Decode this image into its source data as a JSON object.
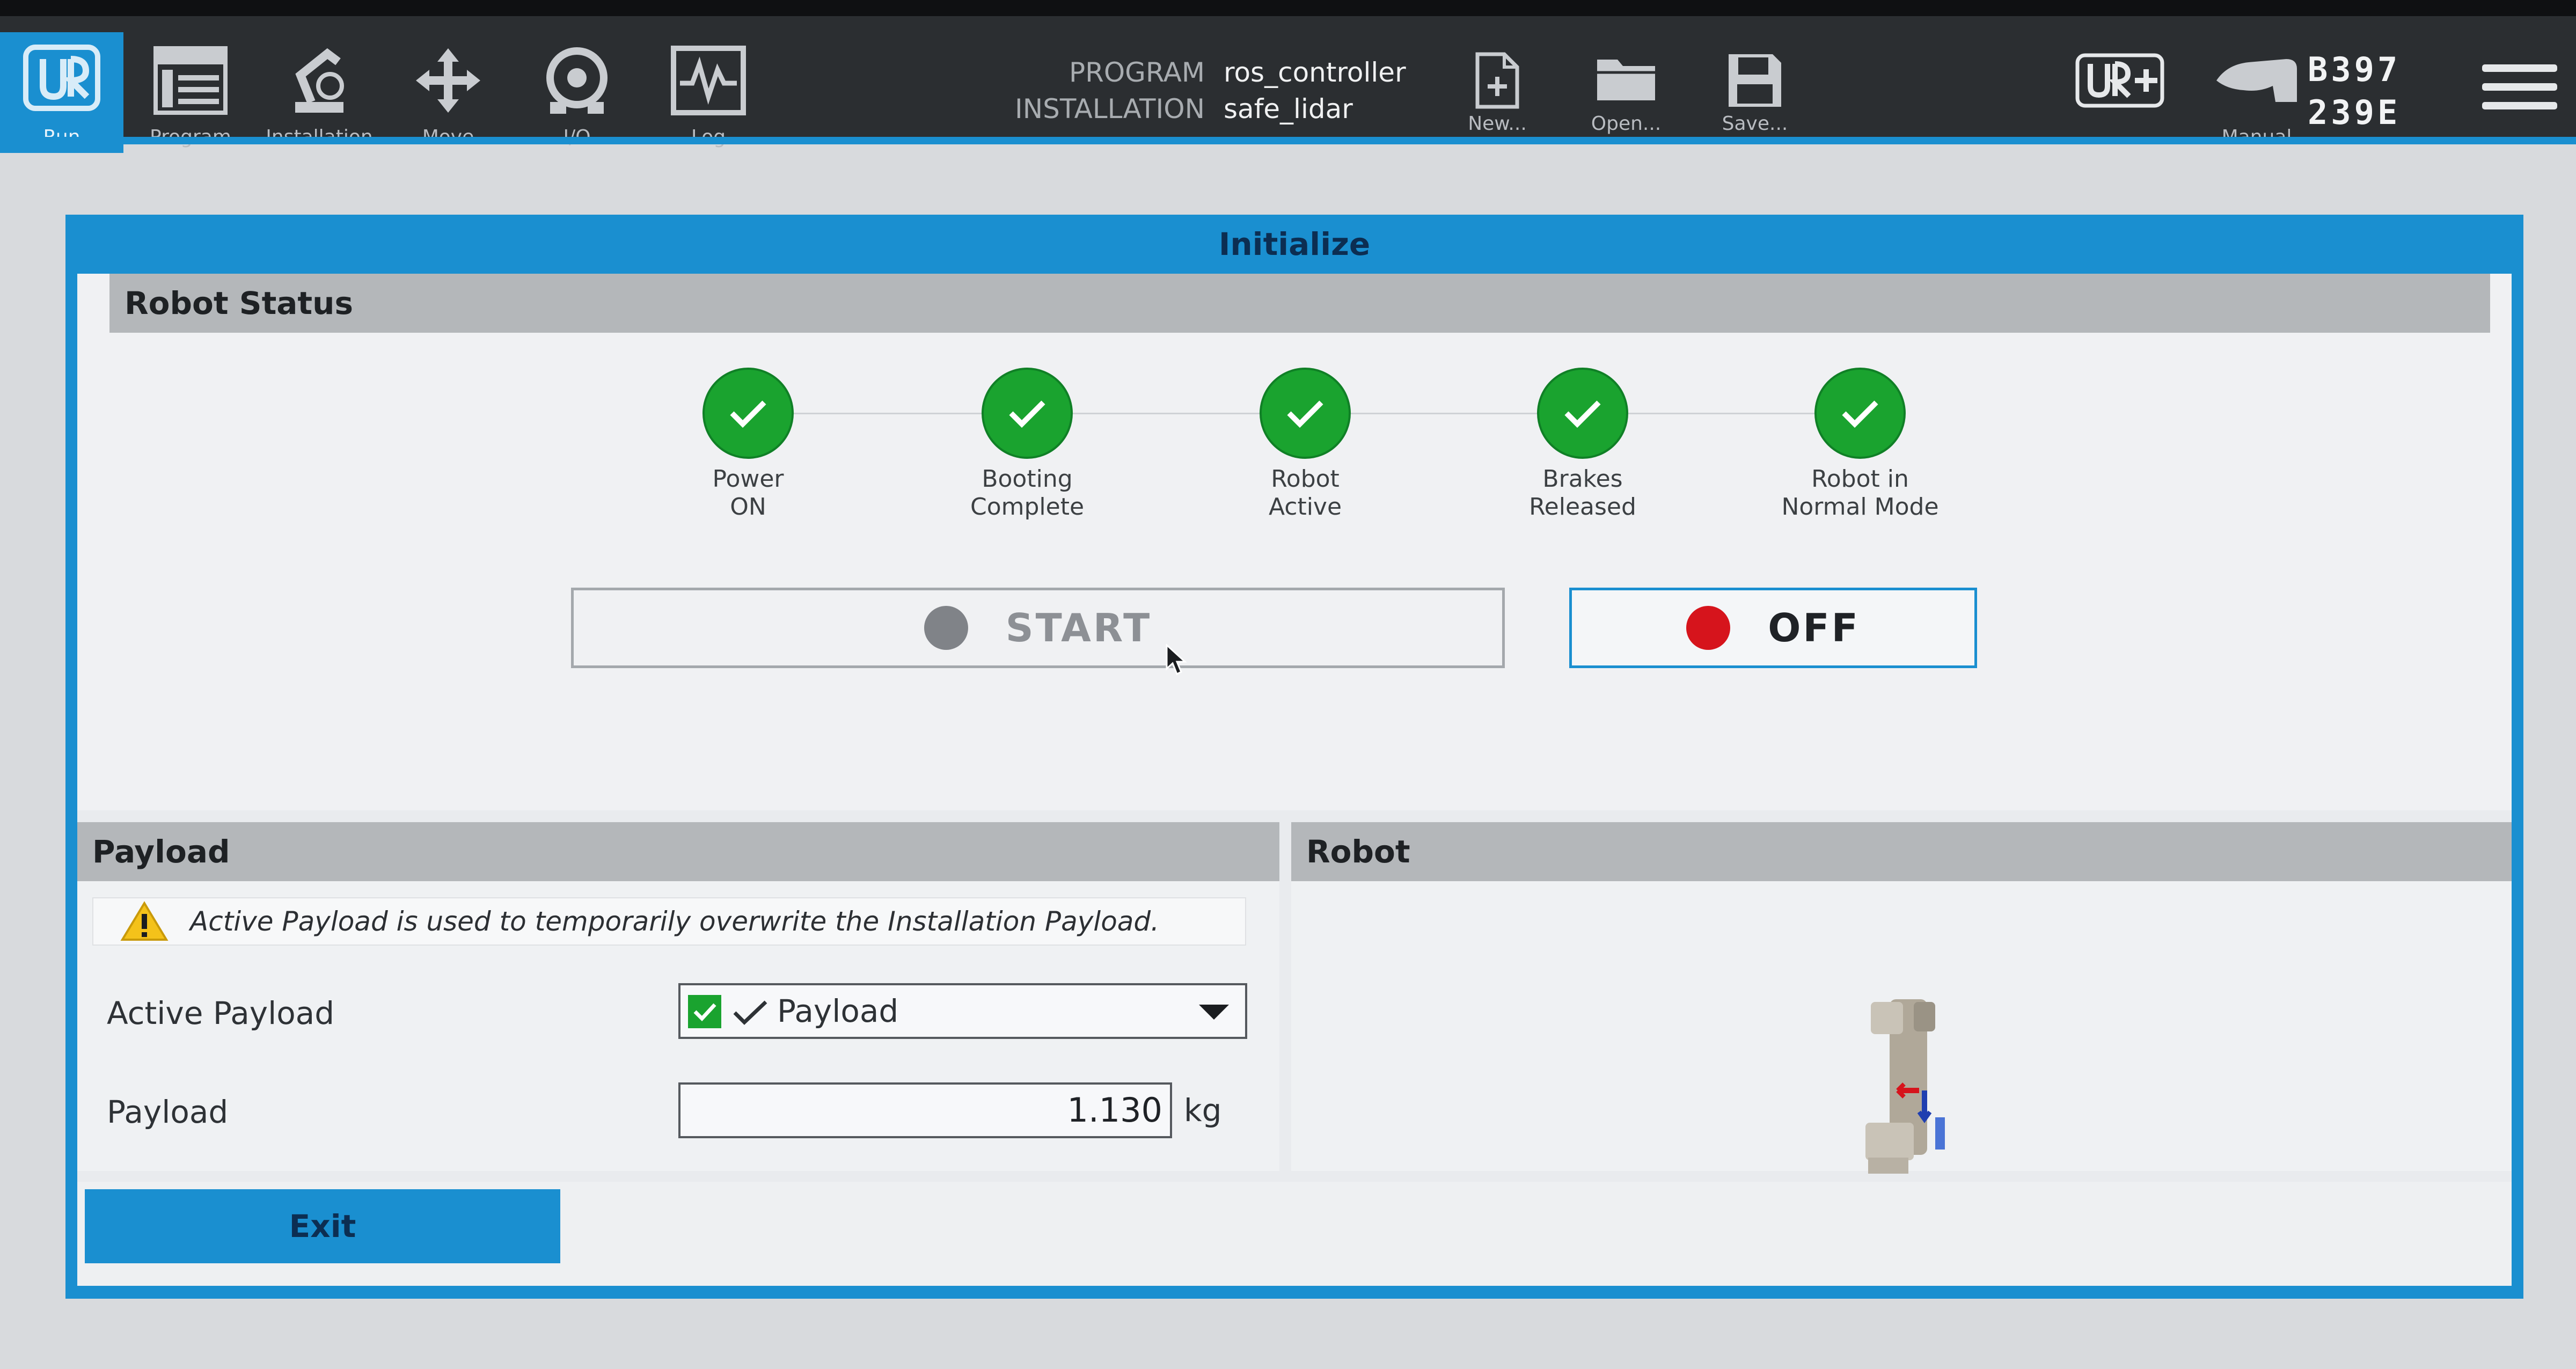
{
  "topbar": {
    "nav": [
      {
        "label": "Run",
        "icon": "ur-logo-icon",
        "active": true
      },
      {
        "label": "Program",
        "icon": "program-icon"
      },
      {
        "label": "Installation",
        "icon": "installation-icon"
      },
      {
        "label": "Move",
        "icon": "move-icon"
      },
      {
        "label": "I/O",
        "icon": "io-icon"
      },
      {
        "label": "Log",
        "icon": "log-icon"
      }
    ],
    "program_key": "PROGRAM",
    "program_value": "ros_controller",
    "installation_key": "INSTALLATION",
    "installation_value": "safe_lidar",
    "file": {
      "new": "New...",
      "open": "Open...",
      "save": "Save..."
    },
    "mode_label": "Manual",
    "serial_line1": "B397",
    "serial_line2": "239E"
  },
  "dialog": {
    "title": "Initialize",
    "robot_status": {
      "heading": "Robot Status",
      "steps": [
        {
          "label": "Power\nON",
          "done": true
        },
        {
          "label": "Booting\nComplete",
          "done": true
        },
        {
          "label": "Robot\nActive",
          "done": true
        },
        {
          "label": "Brakes\nReleased",
          "done": true
        },
        {
          "label": "Robot in\nNormal Mode",
          "done": true
        }
      ],
      "start_label": "START",
      "off_label": "OFF"
    },
    "payload": {
      "heading": "Payload",
      "warning": "Active Payload is used to temporarily overwrite the Installation Payload.",
      "active_label": "Active Payload",
      "active_value": "Payload",
      "payload_label": "Payload",
      "payload_value": "1.130",
      "payload_unit": "kg"
    },
    "robot": {
      "heading": "Robot"
    },
    "exit_label": "Exit"
  },
  "colors": {
    "accent": "#1a8fd0",
    "ok": "#1aa32f",
    "stop": "#d6141c"
  }
}
